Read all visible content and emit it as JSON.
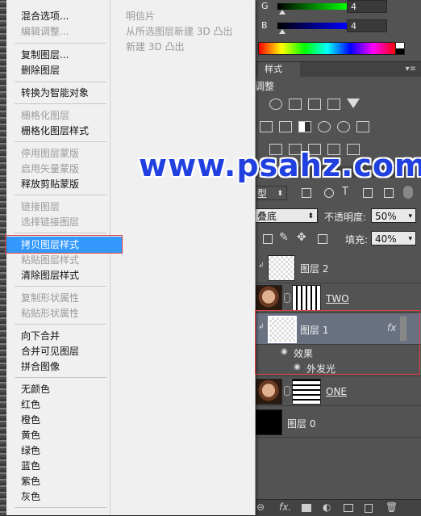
{
  "menu": {
    "items": [
      {
        "label": "混合选项...",
        "enabled": true
      },
      {
        "label": "编辑调整...",
        "enabled": false
      },
      {
        "label": "复制图层...",
        "enabled": true
      },
      {
        "label": "删除图层",
        "enabled": true
      },
      {
        "label": "转换为智能对象",
        "enabled": true
      },
      {
        "label": "栅格化图层",
        "enabled": false
      },
      {
        "label": "栅格化图层样式",
        "enabled": true
      },
      {
        "label": "停用图层蒙版",
        "enabled": false
      },
      {
        "label": "启用矢量蒙版",
        "enabled": false
      },
      {
        "label": "释放剪贴蒙版",
        "enabled": true
      },
      {
        "label": "链接图层",
        "enabled": false
      },
      {
        "label": "选择链接图层",
        "enabled": false
      },
      {
        "label": "拷贝图层样式",
        "enabled": true,
        "highlighted": true
      },
      {
        "label": "粘贴图层样式",
        "enabled": false
      },
      {
        "label": "清除图层样式",
        "enabled": true
      },
      {
        "label": "复制形状属性",
        "enabled": false
      },
      {
        "label": "粘贴形状属性",
        "enabled": false
      },
      {
        "label": "向下合并",
        "enabled": true
      },
      {
        "label": "合并可见图层",
        "enabled": true
      },
      {
        "label": "拼合图像",
        "enabled": true
      },
      {
        "label": "无颜色",
        "enabled": true
      },
      {
        "label": "红色",
        "enabled": true
      },
      {
        "label": "橙色",
        "enabled": true
      },
      {
        "label": "黄色",
        "enabled": true
      },
      {
        "label": "绿色",
        "enabled": true
      },
      {
        "label": "蓝色",
        "enabled": true
      },
      {
        "label": "紫色",
        "enabled": true
      },
      {
        "label": "灰色",
        "enabled": true
      }
    ],
    "secondary": [
      "明信片",
      "从所选图层新建 3D 凸出",
      "新建 3D 凸出"
    ]
  },
  "watermark": "www.psahz.com",
  "color_panel": {
    "g_label": "G",
    "g_value": "4",
    "b_label": "B",
    "b_value": "4"
  },
  "tabs": {
    "styles_tab": "样式",
    "menu_glyph": "▾≡"
  },
  "adjustments": {
    "title": "调整"
  },
  "layers": {
    "filter_kind": "型",
    "blend_mode": "叠底",
    "opacity_label": "不透明度:",
    "opacity_value": "50%",
    "fill_label": "填充:",
    "fill_value": "40%",
    "list": [
      {
        "name": "图层 2"
      },
      {
        "name": "TWO"
      },
      {
        "name": "图层 1",
        "fx": "fx"
      },
      {
        "effects_label": "效果"
      },
      {
        "effect_name": "外发光"
      },
      {
        "name": "ONE"
      },
      {
        "name": "图层 0"
      }
    ]
  },
  "colors": {
    "highlight": "#3399ff",
    "red_box": "#e04040",
    "watermark": "#2040e0"
  }
}
